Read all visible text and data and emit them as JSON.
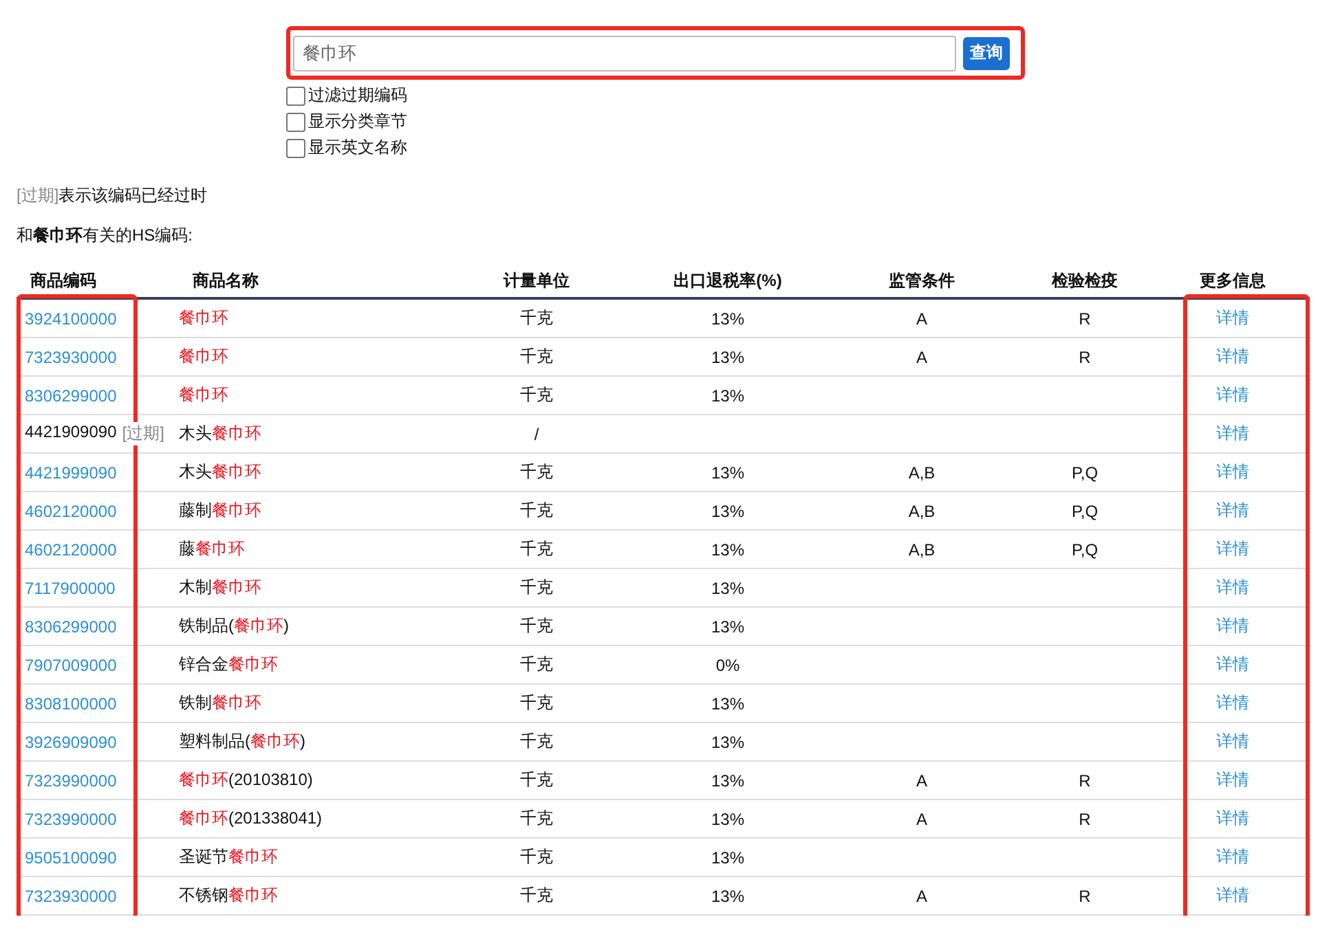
{
  "search": {
    "value": "餐巾环",
    "button": "查询",
    "highlighted": true
  },
  "options": [
    {
      "label": "过滤过期编码",
      "checked": false
    },
    {
      "label": "显示分类章节",
      "checked": false
    },
    {
      "label": "显示英文名称",
      "checked": false
    }
  ],
  "legend": {
    "tag": "[过期]",
    "text": "表示该编码已经过时"
  },
  "heading": "和**餐巾环**有关的HS编码:",
  "table": {
    "columns": [
      {
        "label": "商品编码",
        "highlighted": true
      },
      {
        "label": "商品名称",
        "highlighted": false
      },
      {
        "label": "计量单位",
        "highlighted": false
      },
      {
        "label": "出口退税率(%)",
        "highlighted": false
      },
      {
        "label": "监管条件",
        "highlighted": false
      },
      {
        "label": "检验检疫",
        "highlighted": false
      },
      {
        "label": "更多信息",
        "highlighted": true
      }
    ],
    "rows": [
      {
        "code": "3924100000",
        "expired": false,
        "name": [
          {
            "text": "餐巾环",
            "match": true
          }
        ],
        "unit": "千克",
        "rate": "13%",
        "supervision": "A",
        "inspection": "R",
        "more": "详情"
      },
      {
        "code": "7323930000",
        "expired": false,
        "name": [
          {
            "text": "餐巾环",
            "match": true
          }
        ],
        "unit": "千克",
        "rate": "13%",
        "supervision": "A",
        "inspection": "R",
        "more": "详情"
      },
      {
        "code": "8306299000",
        "expired": false,
        "name": [
          {
            "text": "餐巾环",
            "match": true
          }
        ],
        "unit": "千克",
        "rate": "13%",
        "more": "详情"
      },
      {
        "code": "4421909090",
        "expired": true,
        "expired_tag": "[过期]",
        "name": [
          {
            "text": "木头",
            "match": false
          },
          {
            "text": "餐巾环",
            "match": true
          }
        ],
        "unit": "/",
        "more": "详情"
      },
      {
        "code": "4421999090",
        "expired": false,
        "name": [
          {
            "text": "木头",
            "match": false
          },
          {
            "text": "餐巾环",
            "match": true
          }
        ],
        "unit": "千克",
        "rate": "13%",
        "supervision": "A,B",
        "inspection": "P,Q",
        "more": "详情"
      },
      {
        "code": "4602120000",
        "expired": false,
        "name": [
          {
            "text": "藤制",
            "match": false
          },
          {
            "text": "餐巾环",
            "match": true
          }
        ],
        "unit": "千克",
        "rate": "13%",
        "supervision": "A,B",
        "inspection": "P,Q",
        "more": "详情"
      },
      {
        "code": "4602120000",
        "expired": false,
        "name": [
          {
            "text": "藤",
            "match": false
          },
          {
            "text": "餐巾环",
            "match": true
          }
        ],
        "unit": "千克",
        "rate": "13%",
        "supervision": "A,B",
        "inspection": "P,Q",
        "more": "详情"
      },
      {
        "code": "7117900000",
        "expired": false,
        "name": [
          {
            "text": "木制",
            "match": false
          },
          {
            "text": "餐巾环",
            "match": true
          }
        ],
        "unit": "千克",
        "rate": "13%",
        "more": "详情"
      },
      {
        "code": "8306299000",
        "expired": false,
        "name": [
          {
            "text": "铁制品(",
            "match": false
          },
          {
            "text": "餐巾环",
            "match": true
          },
          {
            "text": ")",
            "match": false
          }
        ],
        "unit": "千克",
        "rate": "13%",
        "more": "详情"
      },
      {
        "code": "7907009000",
        "expired": false,
        "name": [
          {
            "text": "锌合金",
            "match": false
          },
          {
            "text": "餐巾环",
            "match": true
          }
        ],
        "unit": "千克",
        "rate": "0%",
        "more": "详情"
      },
      {
        "code": "8308100000",
        "expired": false,
        "name": [
          {
            "text": "铁制",
            "match": false
          },
          {
            "text": "餐巾环",
            "match": true
          }
        ],
        "unit": "千克",
        "rate": "13%",
        "more": "详情"
      },
      {
        "code": "3926909090",
        "expired": false,
        "name": [
          {
            "text": "塑料制品(",
            "match": false
          },
          {
            "text": "餐巾环",
            "match": true
          },
          {
            "text": ")",
            "match": false
          }
        ],
        "unit": "千克",
        "rate": "13%",
        "more": "详情"
      },
      {
        "code": "7323990000",
        "expired": false,
        "name": [
          {
            "text": "餐巾环",
            "match": true
          },
          {
            "text": "(20103810)",
            "match": false
          }
        ],
        "unit": "千克",
        "rate": "13%",
        "supervision": "A",
        "inspection": "R",
        "more": "详情"
      },
      {
        "code": "7323990000",
        "expired": false,
        "name": [
          {
            "text": "餐巾环",
            "match": true
          },
          {
            "text": "(201338041)",
            "match": false
          }
        ],
        "unit": "千克",
        "rate": "13%",
        "supervision": "A",
        "inspection": "R",
        "more": "详情"
      },
      {
        "code": "9505100090",
        "expired": false,
        "name": [
          {
            "text": "圣诞节",
            "match": false
          },
          {
            "text": "餐巾环",
            "match": true
          }
        ],
        "unit": "千克",
        "rate": "13%",
        "more": "详情"
      },
      {
        "code": "7323930000",
        "expired": false,
        "name": [
          {
            "text": "不锈钢",
            "match": false
          },
          {
            "text": "餐巾环",
            "match": true
          }
        ],
        "unit": "千克",
        "rate": "13%",
        "supervision": "A",
        "inspection": "R",
        "more": "详情"
      }
    ]
  }
}
